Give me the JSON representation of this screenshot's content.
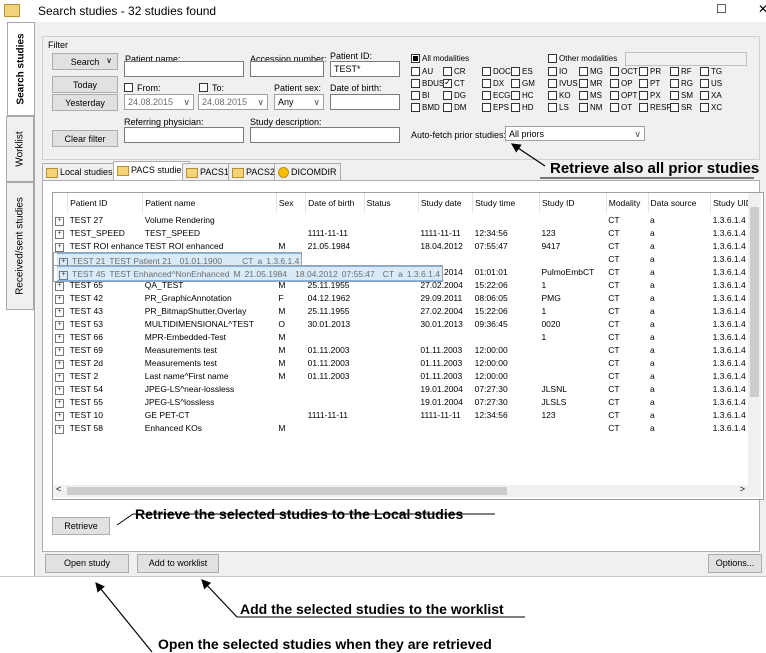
{
  "window": {
    "title": "Search studies - 32 studies found",
    "maximize": "☐",
    "close": "✕"
  },
  "side_tabs": [
    "Search studies",
    "Worklist",
    "Received/sent studies"
  ],
  "filter": {
    "legend": "Filter",
    "search_button": "Search",
    "today_button": "Today",
    "yesterday_button": "Yesterday",
    "clear_button": "Clear filter",
    "patient_name_label": "Patient name:",
    "patient_name_value": "",
    "accession_label": "Accession number:",
    "accession_value": "",
    "patient_id_label": "Patient ID:",
    "patient_id_value": "TEST*",
    "from_label": "From:",
    "to_label": "To:",
    "from_value": "24.08.2015",
    "to_value": "24.08.2015",
    "patient_sex_label": "Patient sex:",
    "patient_sex_value": "Any",
    "dob_label": "Date of birth:",
    "dob_value": "",
    "referring_label": "Referring physician:",
    "referring_value": "",
    "study_desc_label": "Study description:",
    "study_desc_value": "",
    "all_modalities": "All modalities",
    "other_modalities": "Other modalities",
    "modalities_rows": [
      [
        "AU",
        "CR",
        "DOC",
        "ES",
        "IO",
        "MG",
        "OCT",
        "PR",
        "RF",
        "TG"
      ],
      [
        "BDUS",
        "CT",
        "DX",
        "GM",
        "IVUS",
        "MR",
        "OP",
        "PT",
        "RG",
        "US"
      ],
      [
        "BI",
        "DG",
        "ECG",
        "HC",
        "KO",
        "MS",
        "OPT",
        "PX",
        "SM",
        "XA"
      ],
      [
        "BMD",
        "DM",
        "EPS",
        "HD",
        "LS",
        "NM",
        "OT",
        "RESP",
        "SR",
        "XC"
      ]
    ],
    "checked_modality": "CT",
    "auto_fetch_label": "Auto-fetch prior studies:",
    "auto_fetch_value": "All priors"
  },
  "source_tabs": [
    "Local studies",
    "PACS studies",
    "PACS1",
    "PACS2",
    "DICOMDIR"
  ],
  "active_source_tab": "PACS studies",
  "table": {
    "columns": [
      "",
      "Patient ID",
      "Patient name",
      "Sex",
      "Date of birth",
      "Status",
      "Study date",
      "Study time",
      "Study ID",
      "Modality",
      "Data source",
      "Study UID"
    ],
    "rows": [
      [
        "TEST 27",
        "Volume Rendering",
        "",
        "",
        "",
        "",
        "",
        "",
        "CT",
        "a",
        "1.3.6.1.4"
      ],
      [
        "TEST_SPEED",
        "TEST_SPEED",
        "",
        "1111-11-11",
        "",
        "1111-11-11",
        "12:34:56",
        "123",
        "CT",
        "a",
        "1.3.6.1.4"
      ],
      [
        "TEST ROI enhanced",
        "TEST ROI enhanced",
        "M",
        "21.05.1984",
        "",
        "18.04.2012",
        "07:55:47",
        "9417",
        "CT",
        "a",
        "1.3.6.1.4"
      ],
      [
        "TEST 22",
        "TEST Patient 22",
        "",
        "",
        "",
        "",
        "",
        "",
        "CT",
        "a",
        "1.3.6.1.4"
      ],
      [
        "TEST 21",
        "TEST Patient 21",
        "",
        "01.01.1900",
        "",
        "",
        "",
        "",
        "CT",
        "a",
        "1.3.6.1.4"
      ],
      [
        "TEST 19",
        "TEST Patient 19",
        "",
        "",
        "",
        "",
        "",
        "",
        "CT",
        "a",
        "1.3.6.1.4"
      ],
      [
        "TEST 45",
        "TEST Enhanced^NonEnhanced",
        "M",
        "21.05.1984",
        "",
        "18.04.2012",
        "07:55:47",
        "",
        "CT",
        "a",
        "1.3.6.1.4"
      ],
      [
        "TEST 61",
        "SEG",
        "M",
        "01.01.1950",
        "",
        "01.01.2014",
        "01:01:01",
        "PulmoEmbCT",
        "CT",
        "a",
        "1.3.6.1.4"
      ],
      [
        "TEST 65",
        "QA_TEST",
        "M",
        "25.11.1955",
        "",
        "27.02.2004",
        "15:22:06",
        "1",
        "CT",
        "a",
        "1.3.6.1.4"
      ],
      [
        "TEST 42",
        "PR_GraphicAnnotation",
        "F",
        "04.12.1962",
        "",
        "29.09.2011",
        "08:06:05",
        "PMG",
        "CT",
        "a",
        "1.3.6.1.4"
      ],
      [
        "TEST 43",
        "PR_BitmapShutter,Overlay",
        "M",
        "25.11.1955",
        "",
        "27.02.2004",
        "15:22:06",
        "1",
        "CT",
        "a",
        "1.3.6.1.4"
      ],
      [
        "TEST 53",
        "MULTIDIMENSIONAL^TEST",
        "O",
        "30.01.2013",
        "",
        "30.01.2013",
        "09:36:45",
        "0020",
        "CT",
        "a",
        "1.3.6.1.4"
      ],
      [
        "TEST 66",
        "MPR-Embedded-Test",
        "M",
        "",
        "",
        "",
        "",
        "1",
        "CT",
        "a",
        "1.3.6.1.4"
      ],
      [
        "TEST 69",
        "Measurements test",
        "M",
        "01.11.2003",
        "",
        "01.11.2003",
        "12:00:00",
        "",
        "CT",
        "a",
        "1.3.6.1.4"
      ],
      [
        "TEST 2d",
        "Measurements test",
        "M",
        "01.11.2003",
        "",
        "01.11.2003",
        "12:00:00",
        "",
        "CT",
        "a",
        "1.3.6.1.4"
      ],
      [
        "TEST 2",
        "Last name^First name",
        "M",
        "01.11.2003",
        "",
        "01.11.2003",
        "12:00:00",
        "",
        "CT",
        "a",
        "1.3.6.1.4"
      ],
      [
        "TEST 54",
        "JPEG-LS^near-lossless",
        "",
        "",
        "",
        "19.01.2004",
        "07:27:30",
        "JLSNL",
        "CT",
        "a",
        "1.3.6.1.4"
      ],
      [
        "TEST 55",
        "JPEG-LS^lossless",
        "",
        "",
        "",
        "19.01.2004",
        "07:27:30",
        "JLSLS",
        "CT",
        "a",
        "1.3.6.1.4"
      ],
      [
        "TEST 10",
        "GE PET-CT",
        "",
        "1111-11-11",
        "",
        "1111-11-11",
        "12:34:56",
        "123",
        "CT",
        "a",
        "1.3.6.1.4"
      ],
      [
        "TEST 58",
        "Enhanced KOs",
        "M",
        "",
        "",
        "",
        "",
        "",
        "CT",
        "a",
        "1.3.6.1.4"
      ]
    ],
    "selected_rows": [
      3,
      4,
      6
    ]
  },
  "retrieve_button": "Retrieve",
  "open_study_button": "Open study",
  "add_worklist_button": "Add to worklist",
  "options_button": "Options...",
  "annotations": {
    "prior": "Retrieve also all prior studies",
    "retrieve": "Retrieve the selected studies to the Local studies",
    "worklist": "Add the selected studies to the worklist",
    "open": "Open the selected studies when they are retrieved"
  }
}
